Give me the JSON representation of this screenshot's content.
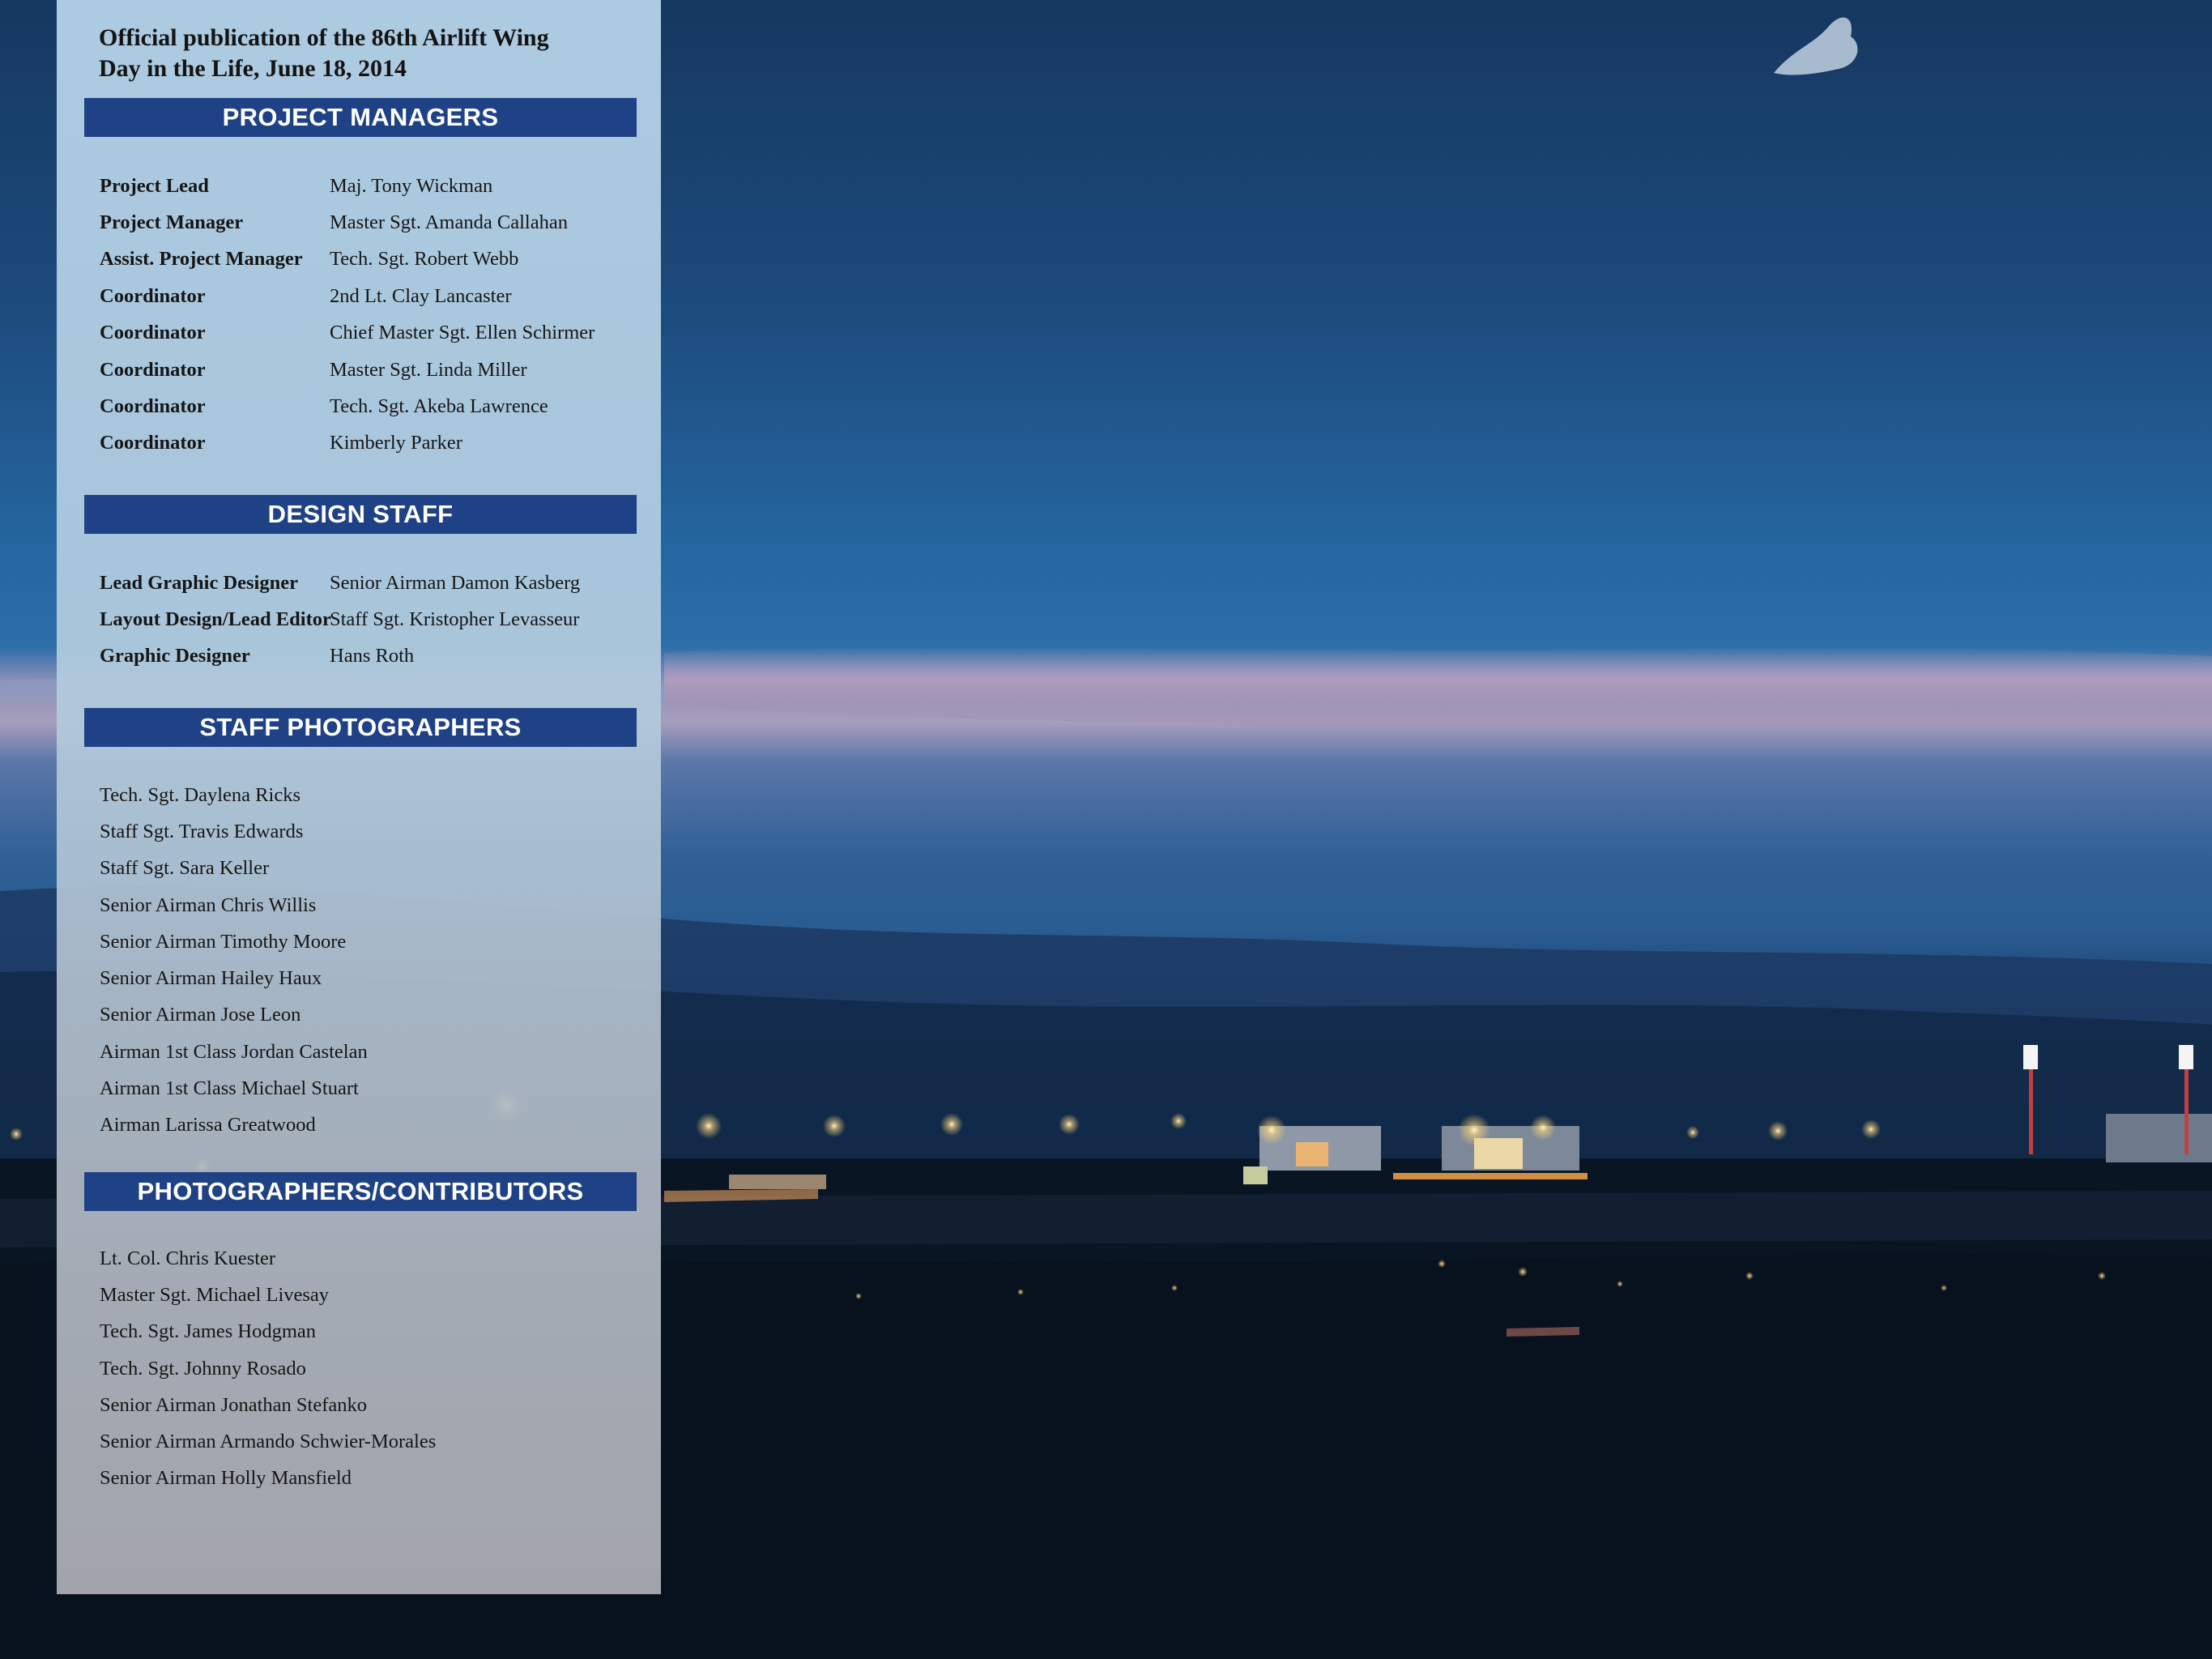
{
  "publication": {
    "line1": "Official publication of the 86th Airlift Wing",
    "line2": "Day in the Life, June 18, 2014"
  },
  "project_managers": {
    "heading": "PROJECT MANAGERS",
    "rows": [
      {
        "role": "Project Lead",
        "name": "Maj. Tony Wickman"
      },
      {
        "role": "Project Manager",
        "name": "Master Sgt. Amanda Callahan"
      },
      {
        "role": "Assist. Project Manager",
        "name": "Tech. Sgt. Robert Webb"
      },
      {
        "role": "Coordinator",
        "name": "2nd Lt. Clay Lancaster"
      },
      {
        "role": "Coordinator",
        "name": "Chief Master Sgt. Ellen Schirmer"
      },
      {
        "role": "Coordinator",
        "name": "Master Sgt. Linda Miller"
      },
      {
        "role": "Coordinator",
        "name": "Tech. Sgt. Akeba Lawrence"
      },
      {
        "role": "Coordinator",
        "name": "Kimberly Parker"
      }
    ]
  },
  "design_staff": {
    "heading": "DESIGN STAFF",
    "rows": [
      {
        "role": "Lead Graphic Designer",
        "name": "Senior Airman Damon Kasberg"
      },
      {
        "role": "Layout Design/Lead Editor",
        "name": "Staff Sgt. Kristopher Levasseur"
      },
      {
        "role": "Graphic Designer",
        "name": "Hans Roth"
      }
    ]
  },
  "staff_photographers": {
    "heading": "STAFF PHOTOGRAPHERS",
    "names": [
      "Tech. Sgt. Daylena Ricks",
      "Staff Sgt. Travis Edwards",
      "Staff Sgt. Sara Keller",
      "Senior Airman Chris Willis",
      "Senior Airman Timothy Moore",
      "Senior Airman Hailey Haux",
      "Senior Airman Jose Leon",
      "Airman 1st Class Jordan Castelan",
      "Airman 1st Class Michael Stuart",
      "Airman Larissa Greatwood"
    ]
  },
  "contributors": {
    "heading": "PHOTOGRAPHERS/CONTRIBUTORS",
    "names": [
      "Lt. Col. Chris Kuester",
      "Master Sgt. Michael Livesay",
      "Tech. Sgt. James Hodgman",
      "Tech. Sgt. Johnny Rosado",
      "Senior Airman Jonathan Stefanko",
      "Senior Airman Armando Schwier-Morales",
      "Senior Airman Holly Mansfield"
    ]
  },
  "colors": {
    "section_bar": "#1f4185",
    "sky_top": "#17375f",
    "sky_mid": "#2a68a0",
    "dusk_band": "#b2a6c2",
    "ground": "#0a1626",
    "city_lights": "#f7d27a"
  }
}
